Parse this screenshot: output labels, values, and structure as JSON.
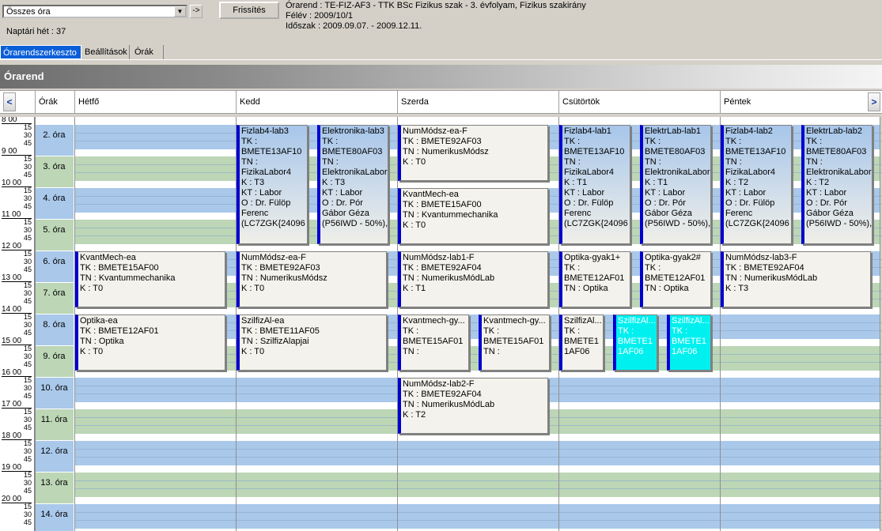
{
  "toolbar": {
    "schedule_select": "Összes óra",
    "go_button": "->",
    "refresh_button": "Frissítés",
    "info_line1": "Órarend : TE-FIZ-AF3 - TTK BSc Fizikus szak - 3. évfolyam, Fizikus szakirány",
    "info_line2": "Félév : 2009/10/1",
    "info_line3": "Időszak : 2009.09.07. - 2009.12.11.",
    "calendar_week": "Naptári hét : 37"
  },
  "tabs": [
    "Órarendszerkeszto",
    "Beállítások",
    "Órák"
  ],
  "panel_title": "Órarend",
  "header": {
    "nav_prev": "<",
    "nav_next": ">",
    "ora_col": "Órák",
    "days": [
      "Hétfő",
      "Kedd",
      "Szerda",
      "Csütörtök",
      "Péntek"
    ]
  },
  "time_labels": {
    "hours": [
      "8 00",
      "9 00",
      "10 00",
      "11 00",
      "12 00",
      "13 00",
      "14 00",
      "15 00",
      "16 00",
      "17 00",
      "18 00",
      "19 00",
      "20 00"
    ],
    "quarters": [
      "15",
      "30",
      "45"
    ]
  },
  "periods": [
    "2. óra",
    "3. óra",
    "4. óra",
    "5. óra",
    "6. óra",
    "7. óra",
    "8. óra",
    "9. óra",
    "10. óra",
    "11. óra",
    "12. óra",
    "13. óra",
    "14. óra"
  ],
  "events": [
    {
      "id": "e1",
      "day": 1,
      "col": 0,
      "ncol": 2,
      "start": 2,
      "span": 4,
      "style": "grad",
      "lines": [
        "Fizlab4-lab3",
        "TK :",
        "BMETE13AF10",
        "TN :",
        "FizikaLabor4",
        "K : T3",
        "KT : Labor",
        "O : Dr. Fülöp",
        "Ferenc",
        "(LC7ZGK{24096"
      ]
    },
    {
      "id": "e2",
      "day": 1,
      "col": 1,
      "ncol": 2,
      "start": 2,
      "span": 4,
      "style": "grad",
      "lines": [
        "Elektronika-lab3",
        "TK :",
        "BMETE80AF03",
        "TN :",
        "ElektronikaLabor",
        "K : T3",
        "KT : Labor",
        "O : Dr. Pór",
        "Gábor Géza",
        "(P56IWD - 50%),"
      ]
    },
    {
      "id": "e3",
      "day": 2,
      "col": 0,
      "ncol": 1,
      "start": 2,
      "span": 2,
      "style": "plain",
      "lines": [
        "NumMódsz-ea-F",
        "TK : BMETE92AF03",
        "TN : NumerikusMódsz",
        "K : T0"
      ]
    },
    {
      "id": "e4",
      "day": 2,
      "col": 0,
      "ncol": 1,
      "start": 4,
      "span": 2,
      "style": "plain",
      "lines": [
        "KvantMech-ea",
        "TK : BMETE15AF00",
        "TN : Kvantummechanika",
        "K : T0"
      ]
    },
    {
      "id": "e5",
      "day": 3,
      "col": 0,
      "ncol": 2,
      "start": 2,
      "span": 4,
      "style": "grad",
      "lines": [
        "Fizlab4-lab1",
        "TK :",
        "BMETE13AF10",
        "TN :",
        "FizikaLabor4",
        "K : T1",
        "KT : Labor",
        "O : Dr. Fülöp",
        "Ferenc",
        "(LC7ZGK{24096"
      ]
    },
    {
      "id": "e6",
      "day": 3,
      "col": 1,
      "ncol": 2,
      "start": 2,
      "span": 4,
      "style": "grad",
      "lines": [
        "ElektrLab-lab1",
        "TK :",
        "BMETE80AF03",
        "TN :",
        "ElektronikaLabor",
        "K : T1",
        "KT : Labor",
        "O : Dr. Pór",
        "Gábor Géza",
        "(P56IWD - 50%),"
      ]
    },
    {
      "id": "e7",
      "day": 4,
      "col": 0,
      "ncol": 2,
      "start": 2,
      "span": 4,
      "style": "grad",
      "lines": [
        "Fizlab4-lab2",
        "TK :",
        "BMETE13AF10",
        "TN :",
        "FizikaLabor4",
        "K : T2",
        "KT : Labor",
        "O : Dr. Fülöp",
        "Ferenc",
        "(LC7ZGK{24096"
      ]
    },
    {
      "id": "e8",
      "day": 4,
      "col": 1,
      "ncol": 2,
      "start": 2,
      "span": 4,
      "style": "grad",
      "lines": [
        "ElektrLab-lab2",
        "TK :",
        "BMETE80AF03",
        "TN :",
        "ElektronikaLabor",
        "K : T2",
        "KT : Labor",
        "O : Dr. Pór",
        "Gábor Géza",
        "(P56IWD - 50%),"
      ]
    },
    {
      "id": "e9",
      "day": 0,
      "col": 0,
      "ncol": 1,
      "start": 6,
      "span": 2,
      "style": "plain",
      "lines": [
        "KvantMech-ea",
        "TK : BMETE15AF00",
        "TN : Kvantummechanika",
        "K : T0"
      ]
    },
    {
      "id": "e10",
      "day": 1,
      "col": 0,
      "ncol": 1,
      "start": 6,
      "span": 2,
      "style": "plain",
      "lines": [
        "NumMódsz-ea-F",
        "TK : BMETE92AF03",
        "TN : NumerikusMódsz",
        "K : T0"
      ]
    },
    {
      "id": "e11",
      "day": 2,
      "col": 0,
      "ncol": 1,
      "start": 6,
      "span": 2,
      "style": "plain",
      "lines": [
        "NumMódsz-lab1-F",
        "TK : BMETE92AF04",
        "TN : NumerikusMódLab",
        "K : T1"
      ]
    },
    {
      "id": "e12",
      "day": 3,
      "col": 0,
      "ncol": 2,
      "start": 6,
      "span": 2,
      "style": "plain",
      "lines": [
        "Optika-gyak1+",
        "TK :",
        "BMETE12AF01",
        "TN : Optika"
      ]
    },
    {
      "id": "e13",
      "day": 3,
      "col": 1,
      "ncol": 2,
      "start": 6,
      "span": 2,
      "style": "plain",
      "lines": [
        "Optika-gyak2#",
        "TK :",
        "BMETE12AF01",
        "TN : Optika"
      ]
    },
    {
      "id": "e14",
      "day": 4,
      "col": 0,
      "ncol": 1,
      "start": 6,
      "span": 2,
      "style": "plain",
      "lines": [
        "NumMódsz-lab3-F",
        "TK : BMETE92AF04",
        "TN : NumerikusMódLab",
        "K : T3"
      ]
    },
    {
      "id": "e15",
      "day": 0,
      "col": 0,
      "ncol": 1,
      "start": 8,
      "span": 2,
      "style": "plain",
      "lines": [
        "Optika-ea",
        "TK : BMETE12AF01",
        "TN : Optika",
        "K : T0"
      ]
    },
    {
      "id": "e16",
      "day": 1,
      "col": 0,
      "ncol": 1,
      "start": 8,
      "span": 2,
      "style": "plain",
      "lines": [
        "SzilfizAl-ea",
        "TK : BMETE11AF05",
        "TN : SzilfizAlapjai",
        "K : T0"
      ]
    },
    {
      "id": "e17",
      "day": 2,
      "col": 0,
      "ncol": 2,
      "start": 8,
      "span": 2,
      "style": "plain",
      "lines": [
        "Kvantmech-gy...",
        "TK :",
        "BMETE15AF01",
        "TN :"
      ]
    },
    {
      "id": "e18",
      "day": 2,
      "col": 1,
      "ncol": 2,
      "start": 8,
      "span": 2,
      "style": "plain",
      "lines": [
        "Kvantmech-gy...",
        "TK :",
        "BMETE15AF01",
        "TN :"
      ]
    },
    {
      "id": "e19",
      "day": 3,
      "col": 0,
      "ncol": 3,
      "start": 8,
      "span": 2,
      "style": "plain",
      "lines": [
        "SzilfizAl...",
        "TK :",
        "BMETE1",
        "1AF06"
      ]
    },
    {
      "id": "e20",
      "day": 3,
      "col": 1,
      "ncol": 3,
      "start": 8,
      "span": 2,
      "style": "cyan",
      "lines": [
        "SzilfizAl...",
        "TK :",
        "BMETE1",
        "1AF06"
      ]
    },
    {
      "id": "e21",
      "day": 3,
      "col": 2,
      "ncol": 3,
      "start": 8,
      "span": 2,
      "style": "cyan",
      "lines": [
        "SzilfizAl...",
        "TK :",
        "BMETE1",
        "1AF06"
      ]
    },
    {
      "id": "e22",
      "day": 2,
      "col": 0,
      "ncol": 1,
      "start": 10,
      "span": 2,
      "style": "plain",
      "lines": [
        "NumMódsz-lab2-F",
        "TK : BMETE92AF04",
        "TN : NumerikusMódLab",
        "K : T2"
      ]
    }
  ]
}
